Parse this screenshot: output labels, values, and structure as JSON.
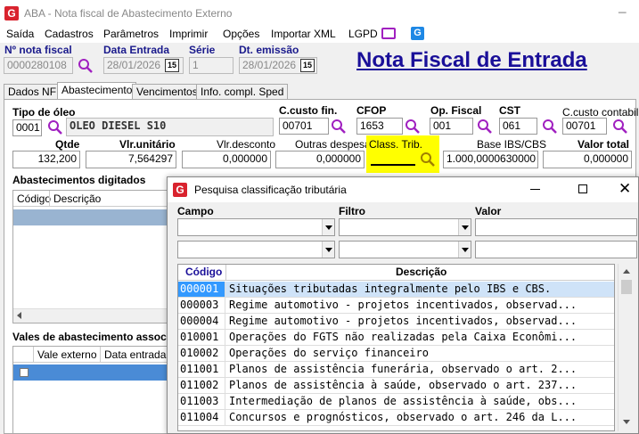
{
  "window": {
    "title": "ABA - Nota fiscal de Abastecimento Externo"
  },
  "menu": [
    "Saída",
    "Cadastros",
    "Parâmetros",
    "Imprimir",
    "Opções",
    "Importar XML",
    "LGPD"
  ],
  "header": {
    "nota_label": "Nº nota fiscal",
    "nota_value": "0000280108",
    "data_entrada_label": "Data Entrada",
    "data_entrada_value": "28/01/2026",
    "serie_label": "Série",
    "serie_value": "1",
    "emissao_label": "Dt. emissão",
    "emissao_value": "28/01/2026",
    "calendar_label": "15",
    "big_title": "Nota Fiscal de Entrada"
  },
  "tabs": [
    "Dados NF",
    "Abastecimento",
    "Vencimentos",
    "Info. compl. Sped"
  ],
  "abastecimento": {
    "tipo_oleo_label": "Tipo de óleo",
    "tipo_oleo_code": "0001",
    "tipo_oleo_desc": "OLEO DIESEL S10",
    "ccusto_fin_label": "C.custo fin.",
    "ccusto_fin_value": "00701",
    "cfop_label": "CFOP",
    "cfop_value": "1653",
    "op_fiscal_label": "Op. Fiscal",
    "op_fiscal_value": "001",
    "cst_label": "CST",
    "cst_value": "061",
    "ccusto_contabil_label": "C.custo contabil",
    "ccusto_contabil_value": "00701",
    "qtde_label": "Qtde",
    "qtde_value": "132,200",
    "vlr_unit_label": "Vlr.unitário",
    "vlr_unit_value": "7,564297",
    "vlr_desc_label": "Vlr.desconto",
    "vlr_desc_value": "0,000000",
    "outras_label": "Outras despesas",
    "outras_value": "0,000000",
    "class_trib_label": "Class. Trib.",
    "class_trib_value": "",
    "base_label": "Base IBS/CBS",
    "base_value": "1.000,0000630000",
    "valor_total_label": "Valor total",
    "valor_total_value": "0,000000"
  },
  "digitados": {
    "title": "Abastecimentos digitados",
    "col_codigo": "Código",
    "col_desc": "Descrição"
  },
  "vales": {
    "title": "Vales de abastecimento assoc",
    "col_vale": "Vale externo",
    "col_data": "Data entrada"
  },
  "popup": {
    "title": "Pesquisa classificação tributária",
    "campo_label": "Campo",
    "filtro_label": "Filtro",
    "valor_label": "Valor",
    "col_codigo": "Código",
    "col_desc": "Descrição",
    "rows": [
      {
        "code": "000001",
        "desc": "Situações tributadas integralmente pelo IBS e CBS."
      },
      {
        "code": "000003",
        "desc": "Regime automotivo - projetos incentivados, observad..."
      },
      {
        "code": "000004",
        "desc": "Regime automotivo - projetos incentivados, observad..."
      },
      {
        "code": "010001",
        "desc": "Operações do FGTS não realizadas pela Caixa Econômi..."
      },
      {
        "code": "010002",
        "desc": "Operações do serviço financeiro"
      },
      {
        "code": "011001",
        "desc": "Planos de assistência funerária, observado o art. 2..."
      },
      {
        "code": "011002",
        "desc": "Planos de assistência à saúde, observado o art. 237..."
      },
      {
        "code": "011003",
        "desc": "Intermediação de planos de assistência à saúde, obs..."
      },
      {
        "code": "011004",
        "desc": "Concursos e prognósticos, observado o art. 246 da L..."
      }
    ]
  },
  "colors": {
    "accent": "#1a0f99",
    "highlight": "#ffff00",
    "selection": "#3399ff"
  }
}
